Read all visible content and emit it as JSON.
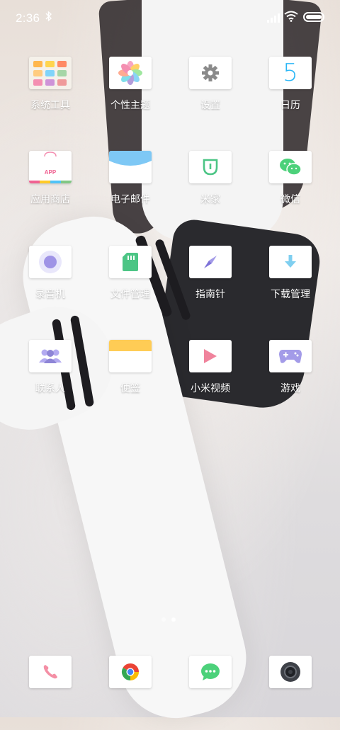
{
  "status_bar": {
    "time": "2:36"
  },
  "apps": [
    {
      "label": "系统工具",
      "icon": "folder-tools-icon"
    },
    {
      "label": "个性主题",
      "icon": "theme-flower-icon"
    },
    {
      "label": "设置",
      "icon": "gear-icon"
    },
    {
      "label": "日历",
      "icon": "calendar-icon",
      "date": "5"
    },
    {
      "label": "应用商店",
      "icon": "app-store-icon",
      "badge": "APP"
    },
    {
      "label": "电子邮件",
      "icon": "mail-icon"
    },
    {
      "label": "米家",
      "icon": "mijia-icon"
    },
    {
      "label": "微信",
      "icon": "wechat-icon"
    },
    {
      "label": "录音机",
      "icon": "recorder-icon"
    },
    {
      "label": "文件管理",
      "icon": "file-manager-icon"
    },
    {
      "label": "指南针",
      "icon": "compass-icon"
    },
    {
      "label": "下载管理",
      "icon": "download-icon"
    },
    {
      "label": "联系人",
      "icon": "contacts-icon"
    },
    {
      "label": "便签",
      "icon": "notes-icon"
    },
    {
      "label": "小米视频",
      "icon": "video-play-icon"
    },
    {
      "label": "游戏",
      "icon": "gamepad-icon"
    }
  ],
  "page_indicator": {
    "pages": 2,
    "current": 2
  },
  "dock": [
    {
      "icon": "phone-icon"
    },
    {
      "icon": "chrome-icon"
    },
    {
      "icon": "messages-icon"
    },
    {
      "icon": "camera-icon"
    }
  ],
  "colors": {
    "status_text": "#ffffff",
    "label_text": "#ffffff",
    "accent_purple": "#8e85d6",
    "accent_green": "#5ccb8a",
    "accent_blue": "#6ecbe6",
    "accent_pink": "#f0839c",
    "accent_yellow": "#ffcc55"
  }
}
